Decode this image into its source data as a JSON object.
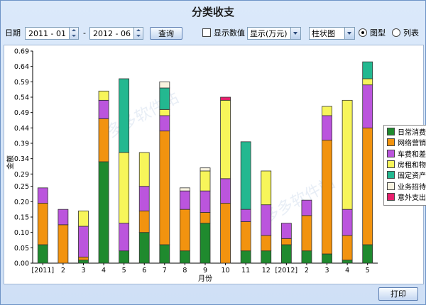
{
  "title": "分类收支",
  "toolbar": {
    "date_label": "日期",
    "start": "2011 - 01",
    "dash": "-",
    "end": "2012 - 06",
    "query": "查询",
    "show_values": "显示数值",
    "unit_select": "显示(万元)",
    "chart_select": "柱状图",
    "radio_chart": "图型",
    "radio_list": "列表"
  },
  "footer": {
    "print": "打印"
  },
  "watermark": "多多软件站",
  "colors": {
    "accent": "#6d93c6"
  },
  "chart_data": {
    "type": "bar",
    "stacked": true,
    "xlabel": "月份",
    "ylabel": "金额",
    "ylim": [
      0,
      0.69
    ],
    "yticks": [
      "0.00",
      "0.05",
      "0.10",
      "0.15",
      "0.20",
      "0.25",
      "0.29",
      "0.34",
      "0.39",
      "0.44",
      "0.49",
      "0.54",
      "0.59",
      "0.64",
      "0.69"
    ],
    "categories": [
      "[2011]",
      "2",
      "3",
      "4",
      "5",
      "6",
      "7",
      "8",
      "9",
      "10",
      "11",
      "12",
      "[2012]",
      "2",
      "3",
      "4",
      "5"
    ],
    "grid": false,
    "legend_position": "right",
    "series": [
      {
        "name": "日常消费",
        "color": "#1f8a2e",
        "values": [
          0.06,
          0,
          0.01,
          0.33,
          0.04,
          0.1,
          0.06,
          0.04,
          0.13,
          0,
          0.04,
          0.04,
          0.06,
          0.04,
          0.03,
          0.01,
          0.06
        ]
      },
      {
        "name": "网络营销",
        "color": "#f2930f",
        "values": [
          0.135,
          0.125,
          0.01,
          0.14,
          0,
          0.07,
          0.37,
          0.135,
          0.035,
          0.195,
          0.095,
          0.05,
          0.02,
          0.115,
          0.37,
          0.08,
          0.38
        ]
      },
      {
        "name": "车费和差旅",
        "color": "#bb55dd",
        "values": [
          0.05,
          0.05,
          0.1,
          0.06,
          0.09,
          0.08,
          0.05,
          0.06,
          0.07,
          0.08,
          0.04,
          0.1,
          0.05,
          0.05,
          0.08,
          0.085,
          0.14
        ]
      },
      {
        "name": "房租和物业",
        "color": "#f7f55a",
        "values": [
          0,
          0,
          0.05,
          0.03,
          0.23,
          0.11,
          0.02,
          0,
          0.065,
          0.255,
          0,
          0.11,
          0,
          0,
          0.03,
          0.355,
          0.02
        ]
      },
      {
        "name": "固定资产",
        "color": "#23b890",
        "values": [
          0,
          0,
          0,
          0,
          0.24,
          0,
          0.07,
          0,
          0,
          0,
          0.22,
          0,
          0,
          0,
          0,
          0,
          0.055
        ]
      },
      {
        "name": "业务招待费",
        "color": "#f8f3e0",
        "values": [
          0,
          0,
          0,
          0,
          0,
          0,
          0.02,
          0.01,
          0.01,
          0,
          0,
          0,
          0,
          0,
          0,
          0,
          0
        ]
      },
      {
        "name": "意外支出",
        "color": "#e8206e",
        "values": [
          0,
          0,
          0,
          0,
          0,
          0,
          0,
          0,
          0,
          0.01,
          0,
          0,
          0,
          0,
          0,
          0,
          0
        ]
      }
    ]
  }
}
